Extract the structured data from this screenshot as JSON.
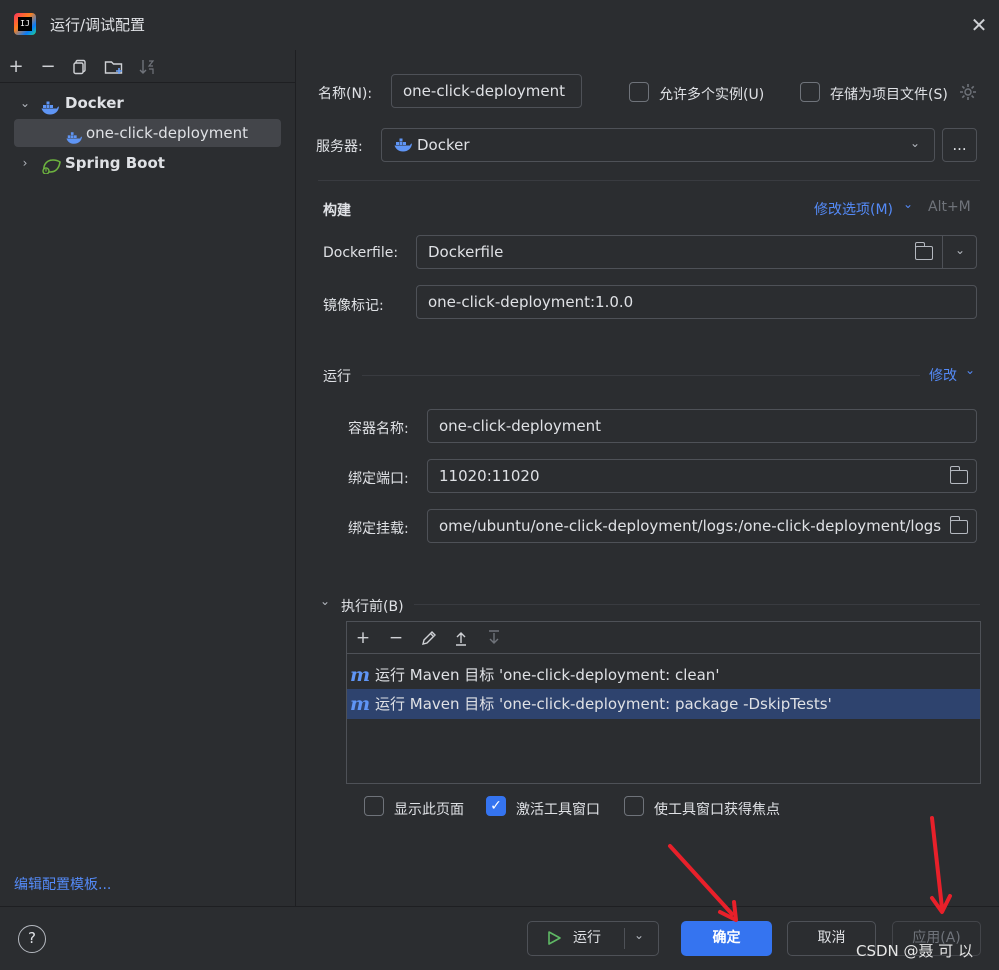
{
  "window": {
    "title": "运行/调试配置"
  },
  "left": {
    "toolbar": [
      "add-icon",
      "remove-icon",
      "copy-icon",
      "new-folder-icon",
      "sort-icon"
    ],
    "tree": {
      "docker": "Docker",
      "docker_child": "one-click-deployment",
      "spring": "Spring Boot"
    },
    "edit_templates": "编辑配置模板..."
  },
  "form": {
    "name_label": "名称(N):",
    "name_value": "one-click-deployment",
    "allow_multi": "允许多个实例(U)",
    "store_as_file": "存储为项目文件(S)",
    "server_label": "服务器:",
    "server_value": "Docker",
    "more": "...",
    "build": {
      "title": "构建",
      "modify": "修改选项(M)",
      "shortcut": "Alt+M",
      "dockerfile_label": "Dockerfile:",
      "dockerfile_value": "Dockerfile",
      "tag_label": "镜像标记:",
      "tag_value": "one-click-deployment:1.0.0"
    },
    "run": {
      "title": "运行",
      "modify": "修改",
      "container_label": "容器名称:",
      "container_value": "one-click-deployment",
      "ports_label": "绑定端口:",
      "ports_value": "11020:11020",
      "mounts_label": "绑定挂载:",
      "mounts_value": "ome/ubuntu/one-click-deployment/logs:/one-click-deployment/logs"
    },
    "before": {
      "title": "执行前(B)",
      "items": [
        "运行 Maven 目标 'one-click-deployment: clean'",
        "运行 Maven 目标 'one-click-deployment: package -DskipTests'"
      ],
      "maven_glyph": "m",
      "show_page": "显示此页面",
      "activate_tool": "激活工具窗口",
      "focus_tool": "使工具窗口获得焦点"
    }
  },
  "footer": {
    "help": "?",
    "run": "运行",
    "ok": "确定",
    "cancel": "取消",
    "apply": "应用(A)",
    "watermark": "CSDN @聂 可 以"
  },
  "colors": {
    "accent": "#3574f0",
    "link": "#548af7",
    "selection": "#2e436e",
    "annotation": "#e8202a"
  }
}
